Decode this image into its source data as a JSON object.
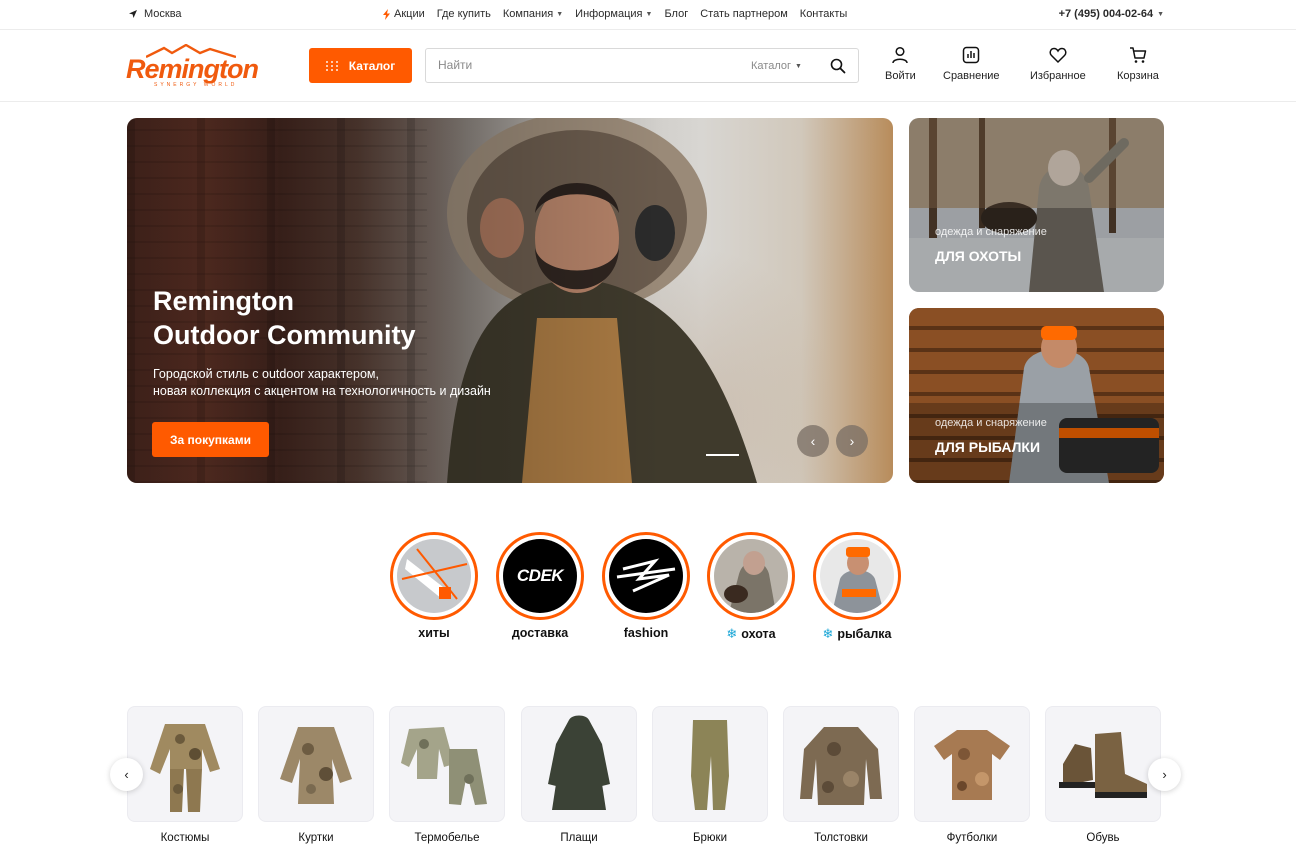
{
  "topbar": {
    "city": "Москва",
    "nav": [
      {
        "label": "Акции",
        "dropdown": false
      },
      {
        "label": "Где купить",
        "dropdown": false
      },
      {
        "label": "Компания",
        "dropdown": true
      },
      {
        "label": "Информация",
        "dropdown": true
      },
      {
        "label": "Блог",
        "dropdown": false
      },
      {
        "label": "Стать партнером",
        "dropdown": false
      },
      {
        "label": "Контакты",
        "dropdown": false
      }
    ],
    "phone": "+7 (495) 004-02-64"
  },
  "header": {
    "logo_text": "Remington",
    "logo_tagline": "SYNERGY WORLD",
    "catalog_button": "Каталог",
    "search": {
      "placeholder": "Найти",
      "scope": "Каталог"
    },
    "actions": {
      "login": "Войти",
      "compare": "Сравнение",
      "favorites": "Избранное",
      "cart": "Корзина"
    }
  },
  "hero": {
    "title_line1": "Remington",
    "title_line2": "Outdoor Community",
    "text_line1": "Городской стиль с outdoor характером,",
    "text_line2": "новая коллекция с акцентом на технологичность и дизайн",
    "cta": "За покупками",
    "prev_arrow": "‹",
    "next_arrow": "›"
  },
  "side_banners": [
    {
      "subtitle": "одежда и снаряжение",
      "title": "ДЛЯ ОХОТЫ"
    },
    {
      "subtitle": "одежда и снаряжение",
      "title": "ДЛЯ РЫБАЛКИ"
    }
  ],
  "stories": [
    {
      "label": "хиты",
      "icon": "",
      "logo_text": ""
    },
    {
      "label": "доставка",
      "icon": "",
      "logo_text": "CDEK"
    },
    {
      "label": "fashion",
      "icon": "",
      "logo_text": ""
    },
    {
      "label": "охота",
      "icon": "❄",
      "logo_text": ""
    },
    {
      "label": "рыбалка",
      "icon": "❄",
      "logo_text": ""
    }
  ],
  "categories": [
    {
      "label": "Костюмы"
    },
    {
      "label": "Куртки"
    },
    {
      "label": "Термобелье"
    },
    {
      "label": "Плащи"
    },
    {
      "label": "Брюки"
    },
    {
      "label": "Толстовки"
    },
    {
      "label": "Футболки"
    },
    {
      "label": "Обувь"
    }
  ],
  "carousel": {
    "prev": "‹",
    "next": "›"
  },
  "colors": {
    "accent": "#ff5a00",
    "brand": "#f05a0e",
    "story_ring": "#ff5a00"
  }
}
